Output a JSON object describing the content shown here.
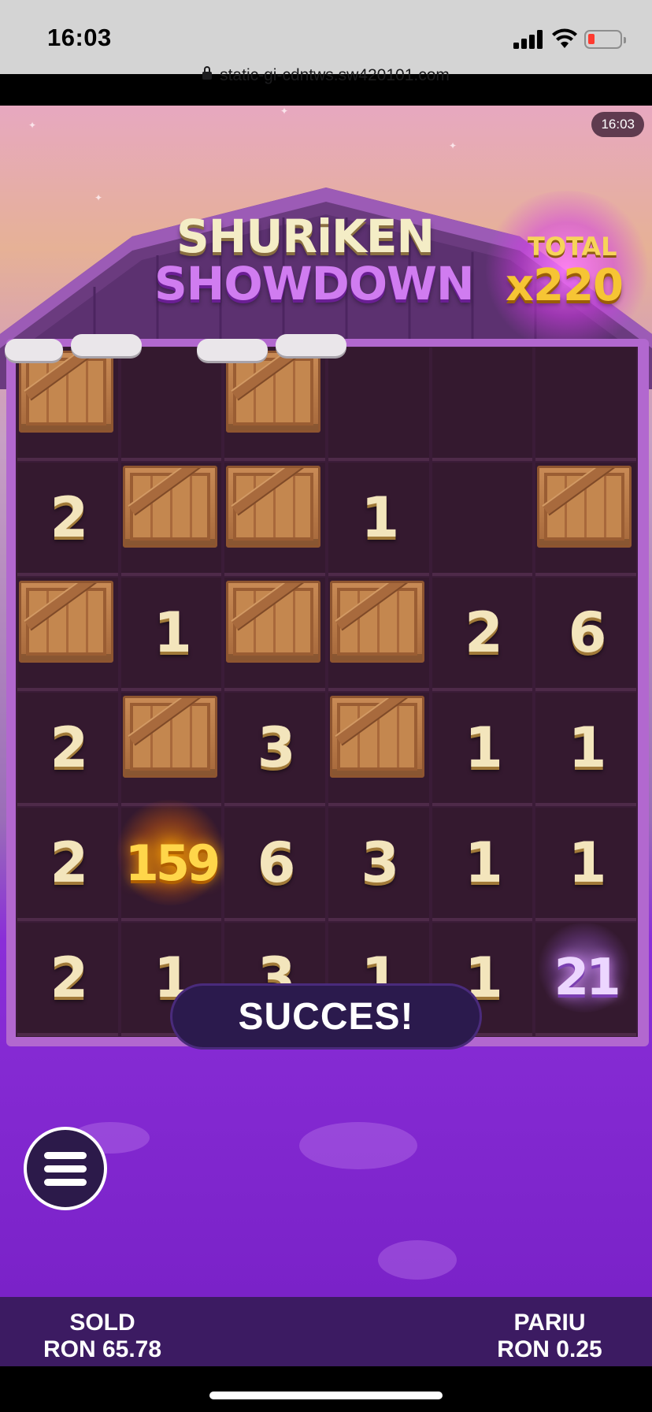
{
  "status_bar": {
    "time": "16:03",
    "url": "static-gi-cdntws.sw420101.com",
    "battery_color": "#ff3b30"
  },
  "game": {
    "clock_badge": "16:03",
    "title_line1": "SHURiKEN",
    "title_line2": "SHOWDOWN",
    "total_label": "TOTAL",
    "total_value": "x220",
    "grid": {
      "columns": 6,
      "rows": 6,
      "cells": [
        [
          "crate",
          "",
          "crate",
          "",
          "",
          ""
        ],
        [
          "2",
          "crate",
          "crate",
          "1",
          "",
          "crate"
        ],
        [
          "crate",
          "1",
          "crate",
          "crate",
          "2",
          "6"
        ],
        [
          "2",
          "crate",
          "3",
          "crate",
          "1",
          "1"
        ],
        [
          "2",
          "159",
          "6",
          "3",
          "1",
          "1"
        ],
        [
          "2",
          "1",
          "3",
          "1",
          "1",
          "21"
        ]
      ],
      "highlighted": {
        "gold": "159",
        "purple": "21"
      }
    },
    "result_message": "SUCCES!",
    "menu_icon": "hamburger-menu-icon"
  },
  "footer": {
    "balance_label": "SOLD",
    "balance_value": "RON 65.78",
    "bet_label": "PARIU",
    "bet_value": "RON 0.25"
  },
  "colors": {
    "grid_bg": "#34192f",
    "frame": "#b268cf",
    "title_cream": "#f4edc6",
    "title_purple": "#d07cf0",
    "total_gold": "#f6c534",
    "info_bar": "#3c1b62"
  }
}
